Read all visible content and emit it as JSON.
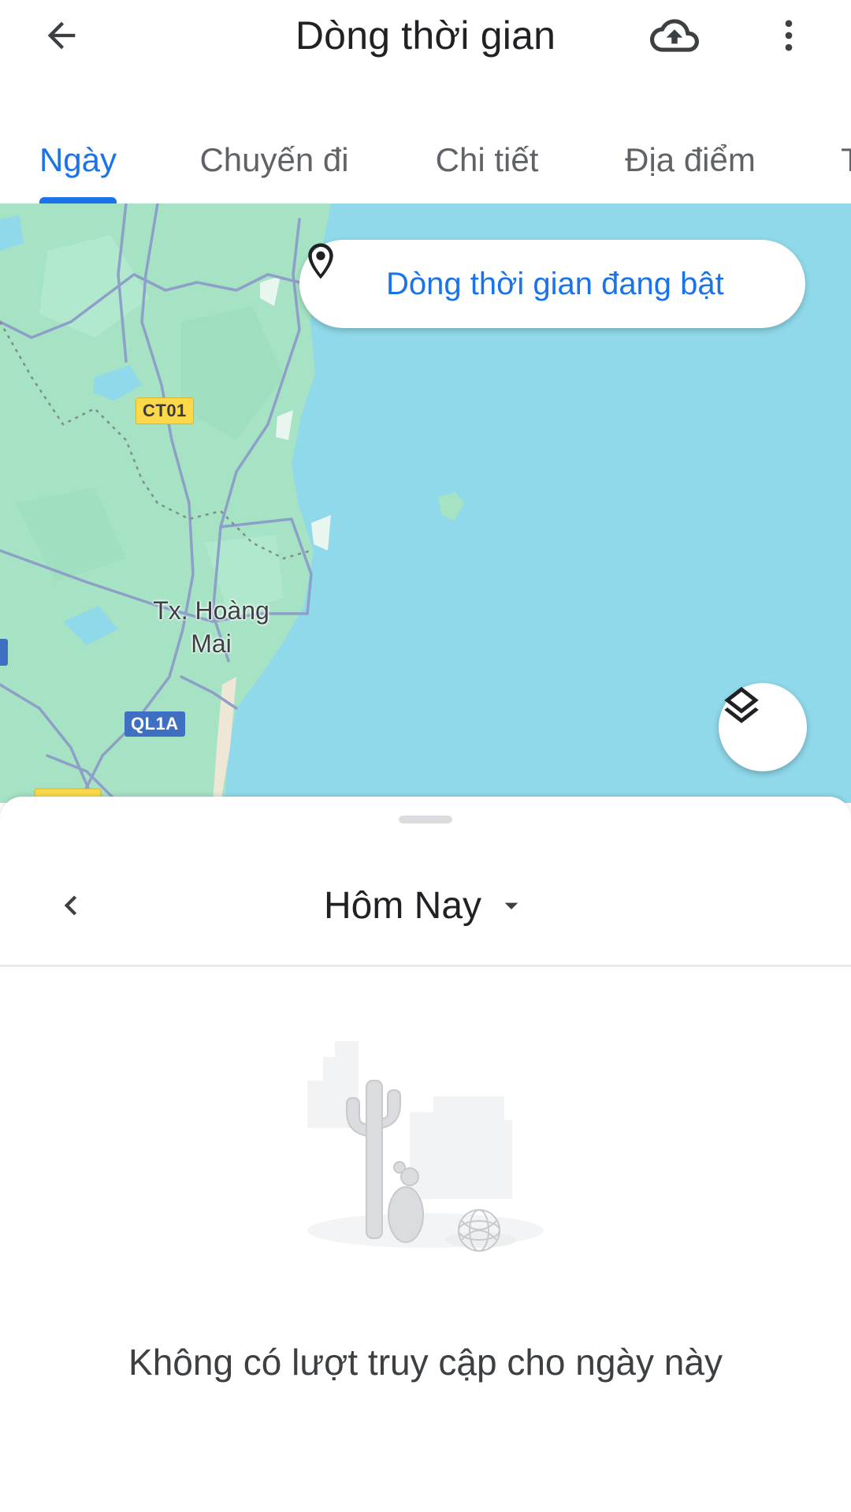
{
  "app_bar": {
    "title": "Dòng thời gian",
    "back_icon": "arrow-back-icon",
    "upload_icon": "cloud-upload-icon",
    "more_icon": "more-vert-icon"
  },
  "tabs": {
    "items": [
      {
        "label": "Ngày",
        "active": true
      },
      {
        "label": "Chuyến đi",
        "active": false
      },
      {
        "label": "Chi tiết",
        "active": false
      },
      {
        "label": "Địa điểm",
        "active": false
      },
      {
        "label": "T",
        "active": false
      }
    ]
  },
  "map": {
    "status_pill": "Dòng thời gian đang bật",
    "town_label_line1": "Tx. Hoàng",
    "town_label_line2": "Mai",
    "road_labels": [
      "CT01",
      "QL1A"
    ],
    "layers_icon": "layers-icon",
    "colors": {
      "water": "#8fd9ea",
      "land": "#a6e3c5",
      "road": "#8e9fc8",
      "accent": "#1a73e8"
    }
  },
  "sheet": {
    "date_label": "Hôm Nay",
    "prev_icon": "chevron-left-icon",
    "dropdown_icon": "arrow-drop-down-icon",
    "empty_message": "Không có lượt truy cập cho ngày này"
  }
}
